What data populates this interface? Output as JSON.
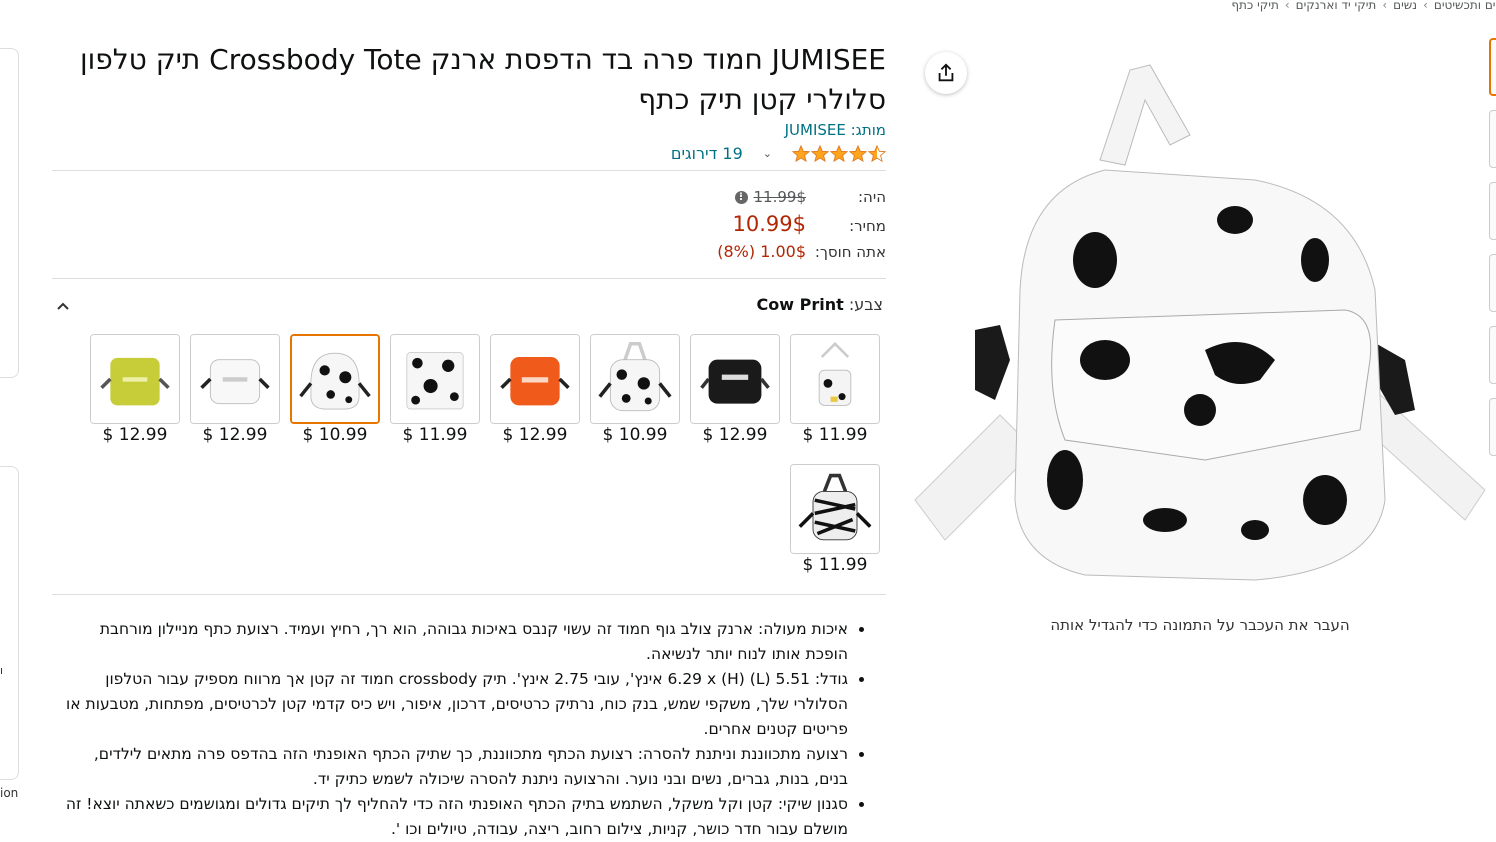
{
  "breadcrumb": [
    "ליים ותכשיטים",
    "נשים",
    "תיקי יד וארנקים",
    "תיקי כתף"
  ],
  "left_edge": {
    "text1": "ו",
    "text2": "ion"
  },
  "title": "JUMISEE חמוד פרה בד הדפסת ארנק Crossbody Tote תיק טלפון סלולרי קטן תיק כתף",
  "brand": {
    "label": "מותג:",
    "value": "JUMISEE"
  },
  "rating": {
    "stars": 4.5,
    "count_text": "19 דירוגים"
  },
  "price": {
    "was_label": "היה:",
    "was_value": "11.99$",
    "now_label": "מחיר:",
    "now_value": "10.99$",
    "save_label": "אתה חוסך:",
    "save_value": "1.00$ (8%)"
  },
  "color": {
    "label": "צבע:",
    "value": "Cow Print"
  },
  "swatches": [
    {
      "name": "cow-print-small",
      "price": "$ 11.99"
    },
    {
      "name": "black",
      "price": "$ 12.99"
    },
    {
      "name": "cow-print",
      "price": "$ 10.99"
    },
    {
      "name": "orange",
      "price": "$ 12.99"
    },
    {
      "name": "cow-print-large",
      "price": "$ 11.99"
    },
    {
      "name": "cow-print-round",
      "price": "$ 10.99"
    },
    {
      "name": "white",
      "price": "$ 12.99"
    },
    {
      "name": "yellow",
      "price": "$ 12.99"
    },
    {
      "name": "zebra",
      "price": "$ 11.99"
    }
  ],
  "selected_swatch": 2,
  "zoom_hint": "העבר את העכבר על התמונה כדי להגדיל אותה",
  "bullets": [
    "איכות מעולה: ארנק צולב גוף חמוד זה עשוי קנבס באיכות גבוהה, הוא רך, רחיץ ועמיד. רצועת כתף מניילון מורחבת הופכת אותו לנוח יותר לנשיאה.",
    "גודל: 5.51 (L) (H) 6.29 x אינץ', עובי 2.75 אינץ'. תיק crossbody חמוד זה קטן אך מרווח מספיק עבור הטלפון הסלולרי שלך, משקפי שמש, בנק כוח, נרתיק כרטיסים, דרכון, איפור, ויש כיס קדמי קטן לכרטיסים, מפתחות, מטבעות או פריטים קטנים אחרים.",
    "רצועה מתכווננת וניתנת להסרה: רצועת הכתף מתכווננת, כך שתיק הכתף האופנתי הזה בהדפס פרה מתאים לילדים, בנים, בנות, גברים, נשים ובני נוער. והרצועה ניתנת להסרה שיכולה לשמש כתיק יד.",
    "סגנון שיקי: קטן וקל משקל, השתמש בתיק הכתף האופנתי הזה כדי להחליף לך תיקים גדולים ומגושמים כשאתה יוצא! זה מושלם עבור חדר כושר, קניות, צילום רחוב, ריצה, עבודה, טיולים וכו '."
  ],
  "colors": {
    "link": "#007185",
    "price": "#b12704",
    "selected_border": "#e77600",
    "star": "#ffa41c"
  }
}
